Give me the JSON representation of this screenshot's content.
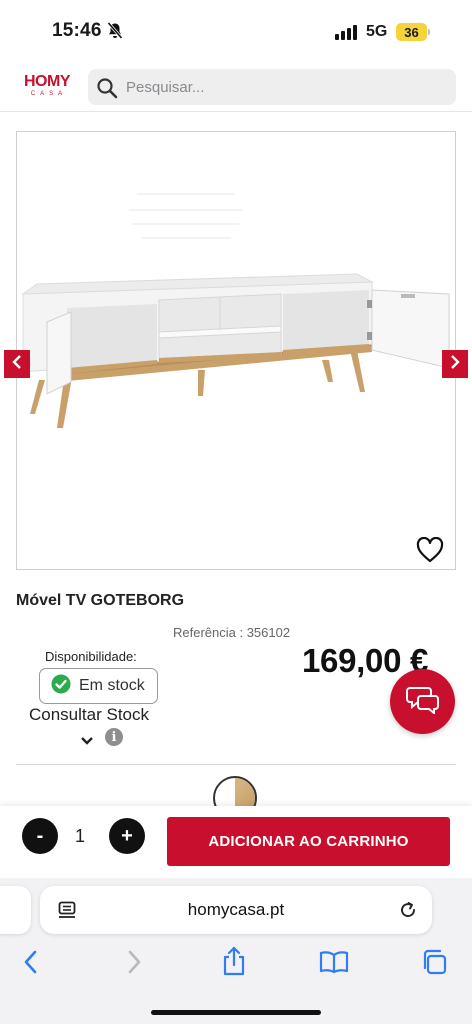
{
  "status_bar": {
    "time": "15:46",
    "network": "5G",
    "battery": "36"
  },
  "header": {
    "logo_main": "HOMY",
    "logo_sub": "CASA",
    "search_placeholder": "Pesquisar..."
  },
  "product": {
    "title": "Móvel TV GOTEBORG",
    "reference": "Referência : 356102",
    "availability_label": "Disponibilidade:",
    "stock_status": "Em stock",
    "price": "169,00 €",
    "consult_stock": "Consultar Stock",
    "info_glyph": "i"
  },
  "cart": {
    "minus": "-",
    "quantity": "1",
    "plus": "+",
    "add_button": "ADICIONAR AO CARRINHO"
  },
  "browser": {
    "url": "homycasa.pt"
  },
  "colors": {
    "brand_red": "#c8102e",
    "stock_green": "#2eaa4e",
    "oak": "#c9a06a"
  },
  "icons": [
    "bell-slash-icon",
    "signal-icon",
    "search-icon",
    "chevron-left-icon",
    "chevron-right-icon",
    "heart-icon",
    "check-circle-icon",
    "chat-icon",
    "chevron-down-icon",
    "info-icon",
    "reader-icon",
    "reload-icon",
    "back-icon",
    "forward-icon",
    "share-icon",
    "bookmarks-icon",
    "tabs-icon"
  ]
}
